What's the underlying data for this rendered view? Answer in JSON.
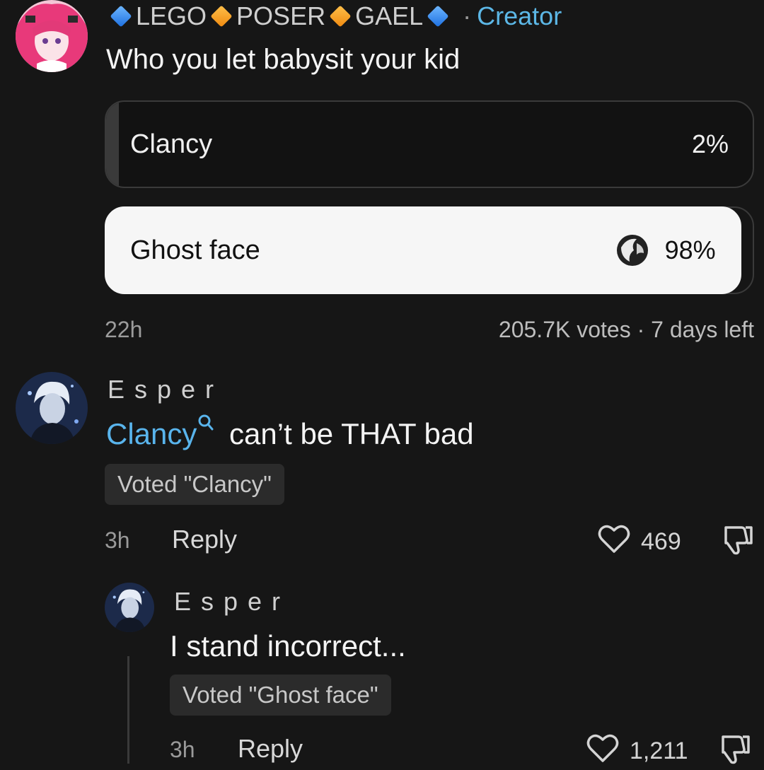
{
  "post": {
    "author_parts": [
      "LEGO",
      "POSER",
      "GAEL"
    ],
    "separator": "·",
    "creator_badge": "Creator",
    "text": "Who you let babysit your kid",
    "avatar_icon": "anime-avatar-pink-hair"
  },
  "poll": {
    "options": [
      {
        "label": "Clancy",
        "percent_text": "2%",
        "percent": 2,
        "voted": false
      },
      {
        "label": "Ghost face",
        "percent_text": "98%",
        "percent": 98,
        "voted": true
      }
    ],
    "time": "22h",
    "meta": "205.7K votes · 7 days left"
  },
  "comments": [
    {
      "author": "Esper",
      "mention": "Clancy",
      "text": " can’t be THAT bad",
      "vote_chip": "Voted \"Clancy\"",
      "time": "3h",
      "reply_label": "Reply",
      "likes": "469",
      "avatar_icon": "anime-avatar-white-hair"
    },
    {
      "author": "Esper",
      "text": "I stand incorrect...",
      "vote_chip": "Voted \"Ghost face\"",
      "time": "3h",
      "reply_label": "Reply",
      "likes": "1,211",
      "avatar_icon": "anime-avatar-white-hair"
    }
  ],
  "colors": {
    "background": "#161616",
    "creator_badge": "#5cb7e6",
    "mention": "#59b4ec",
    "winning_bar": "#f6f6f6",
    "losing_bar": "#3a3a3a"
  }
}
